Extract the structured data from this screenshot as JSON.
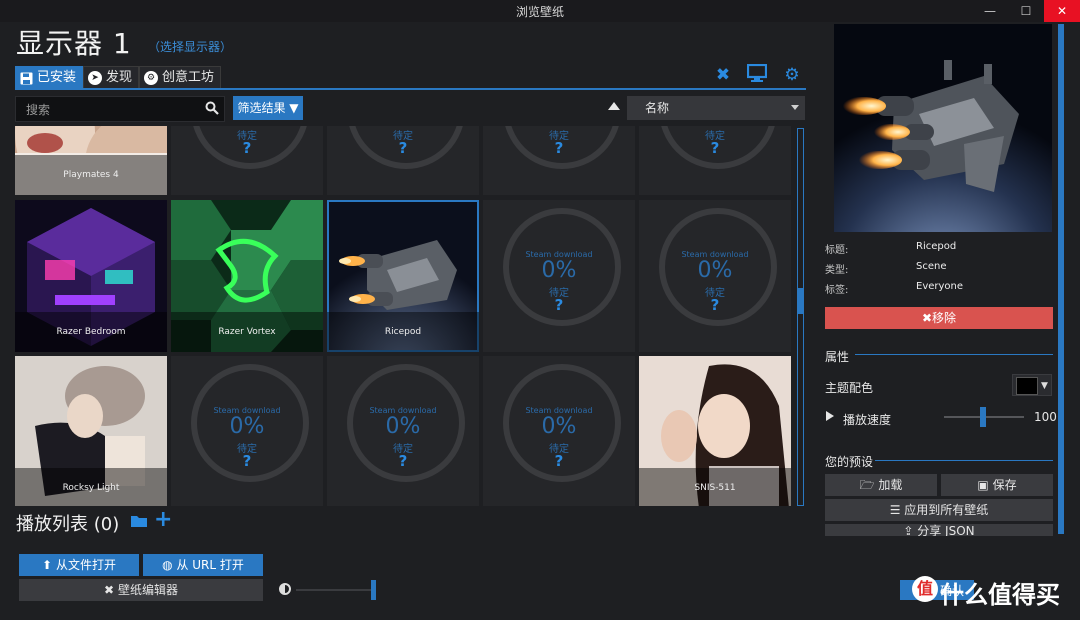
{
  "window": {
    "title": "浏览壁纸",
    "min": "—",
    "max": "☐",
    "close": "✕"
  },
  "header": {
    "monitor_title": "显示器 1",
    "select_monitor": "（选择显示器）"
  },
  "tabs": [
    {
      "label": "已安装",
      "icon": "save-icon"
    },
    {
      "label": "发现",
      "icon": "compass-icon"
    },
    {
      "label": "创意工坊",
      "icon": "steam-icon"
    }
  ],
  "toolbar_icons": [
    "tools-icon",
    "monitor-icon",
    "settings-gear-icon"
  ],
  "search": {
    "placeholder": "搜索"
  },
  "filter": {
    "label": "筛选结果"
  },
  "sort": {
    "selected": "名称"
  },
  "tiles": {
    "row1": {
      "playmates": "Playmates 4",
      "wait": "待定",
      "q": "?"
    },
    "razer_bedroom": "Razer Bedroom",
    "razer_vortex": "Razer Vortex",
    "ricepod": "Ricepod",
    "rocksy": "Rocksy Light",
    "snis": "SNIS-511",
    "download": {
      "label": "Steam download",
      "percent": "0%",
      "wait": "待定",
      "q": "?"
    }
  },
  "playlist": {
    "title": "播放列表 (0)"
  },
  "bottom": {
    "open_file": "从文件打开",
    "open_url": "从 URL 打开",
    "editor": "壁纸编辑器"
  },
  "details": {
    "title_key": "标题:",
    "title_val": "Ricepod",
    "type_key": "类型:",
    "type_val": "Scene",
    "tag_key": "标签:",
    "tag_val": "Everyone",
    "remove": "移除"
  },
  "properties": {
    "section": "属性",
    "theme_color": "主题配色",
    "theme_color_value": "#000000",
    "play_speed": "播放速度",
    "play_speed_value": "100"
  },
  "presets": {
    "section": "您的预设",
    "load": "加载",
    "save": "保存",
    "apply_all": "应用到所有壁纸",
    "share_json": "分享 JSON"
  },
  "ok_label": "确认",
  "watermark": {
    "text": "什么值得买",
    "logo": "值"
  },
  "colors": {
    "accent": "#2a78c2",
    "danger": "#d9534f",
    "background": "#1e1f22"
  }
}
